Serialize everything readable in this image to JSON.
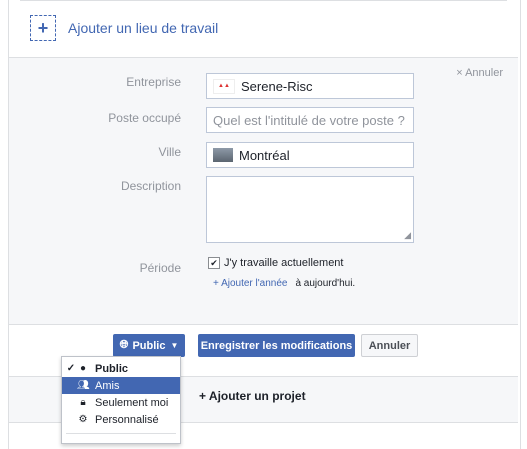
{
  "header": {
    "add_workplace": "Ajouter un lieu de travail",
    "add_icon": "plus-icon"
  },
  "form": {
    "cancel_top": "× Annuler",
    "company": {
      "label": "Entreprise",
      "value": "Serene-Risc"
    },
    "position": {
      "label": "Poste occupé",
      "placeholder": "Quel est l'intitulé de votre poste ?"
    },
    "city": {
      "label": "Ville",
      "value": "Montréal"
    },
    "description": {
      "label": "Description",
      "value": ""
    },
    "period": {
      "label": "Période",
      "currently_working": "J'y travaille actuellement",
      "currently_checked": true,
      "add_year": "+ Ajouter l'année",
      "to_today": "à aujourd'hui."
    }
  },
  "actions": {
    "privacy_button": "Public",
    "save_button": "Enregistrer les modifications",
    "cancel_button": "Annuler"
  },
  "privacy_menu": {
    "items": [
      {
        "label": "Public",
        "icon": "globe-icon",
        "selected": true
      },
      {
        "label": "Amis",
        "icon": "friends-icon",
        "selected": false
      },
      {
        "label": "Seulement moi",
        "icon": "lock-icon",
        "selected": false
      },
      {
        "label": "Personnalisé",
        "icon": "gear-icon",
        "selected": false
      }
    ]
  },
  "add_project": "+ Ajouter un projet",
  "colors": {
    "brand": "#4267b2",
    "background": "#f6f7f9",
    "label": "#90949c"
  }
}
